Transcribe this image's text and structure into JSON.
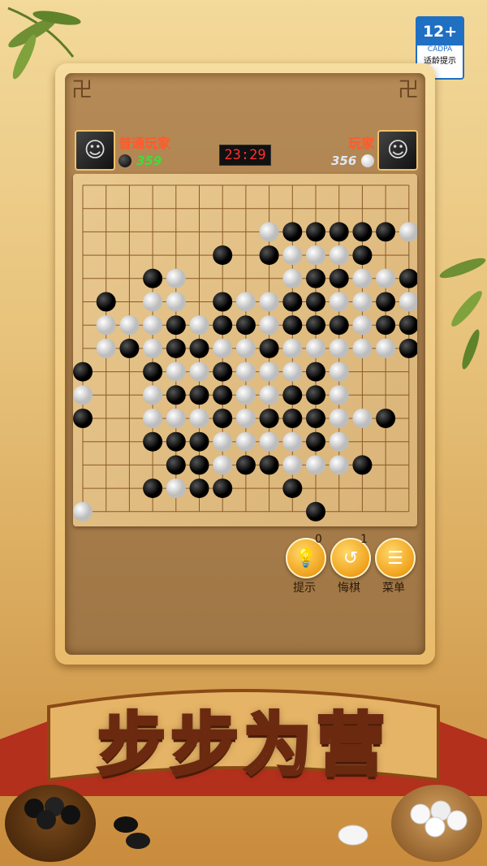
{
  "age_rating": {
    "badge": "12+",
    "org": "CADPA",
    "note": "适龄提示"
  },
  "left_player": {
    "name": "普通玩家",
    "score": "359",
    "stone": "black"
  },
  "right_player": {
    "name": "玩家",
    "score": "356",
    "stone": "white"
  },
  "timer": "23:29",
  "controls": {
    "hint": {
      "label": "提示",
      "count": "0"
    },
    "undo": {
      "label": "悔棋",
      "count": "1"
    },
    "menu": {
      "label": "菜单"
    }
  },
  "slogan": "步步为营",
  "board": {
    "size": 15,
    "rows": [
      "...............",
      "............. .",
      "........WBBBBBW",
      "......B.BWWWB..",
      "...BW....WBBWWB",
      ".B.WW BWWBBWWBW",
      ".WWWBWBBWBBBWBB",
      ".WBWBBWWBWWWWWB",
      "B..BWWBWWWBW...",
      "W..WBBBWWBBW...",
      "B..WWWBWBBBWWB.",
      "...BBBWWWWBW...",
      "....BBWBBWWWB..",
      "...BWBB..B.....",
      "W.........B...."
    ]
  }
}
